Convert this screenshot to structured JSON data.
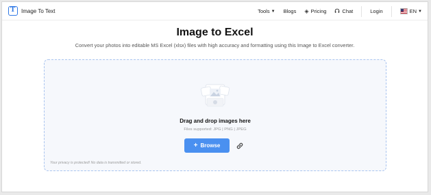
{
  "header": {
    "logo_text": "Image To Text",
    "logo_letter": "T",
    "nav": {
      "tools": "Tools",
      "blogs": "Blogs",
      "pricing": "Pricing",
      "chat": "Chat",
      "login": "Login",
      "language": "EN"
    }
  },
  "main": {
    "title": "Image to Excel",
    "subtitle": "Convert your photos into editable MS Excel (xlsx) files with high accuracy and formatting using this Image to Excel converter."
  },
  "dropzone": {
    "title": "Drag and drop images here",
    "supported": "Files supported: JPG | PNG | JPEG",
    "browse_label": "Browse",
    "privacy_note": "Your privacy is protected! No data is transmitted or stored."
  },
  "colors": {
    "accent": "#4a90f0",
    "brand": "#2e77e5",
    "dropzone_bg": "#f6f8fc",
    "dropzone_border": "#a9c4ef"
  },
  "icons": [
    "logo-icon",
    "chevron-down-icon",
    "tag-icon",
    "headset-icon",
    "us-flag-icon",
    "image-upload-icon",
    "plus-icon",
    "link-icon"
  ]
}
